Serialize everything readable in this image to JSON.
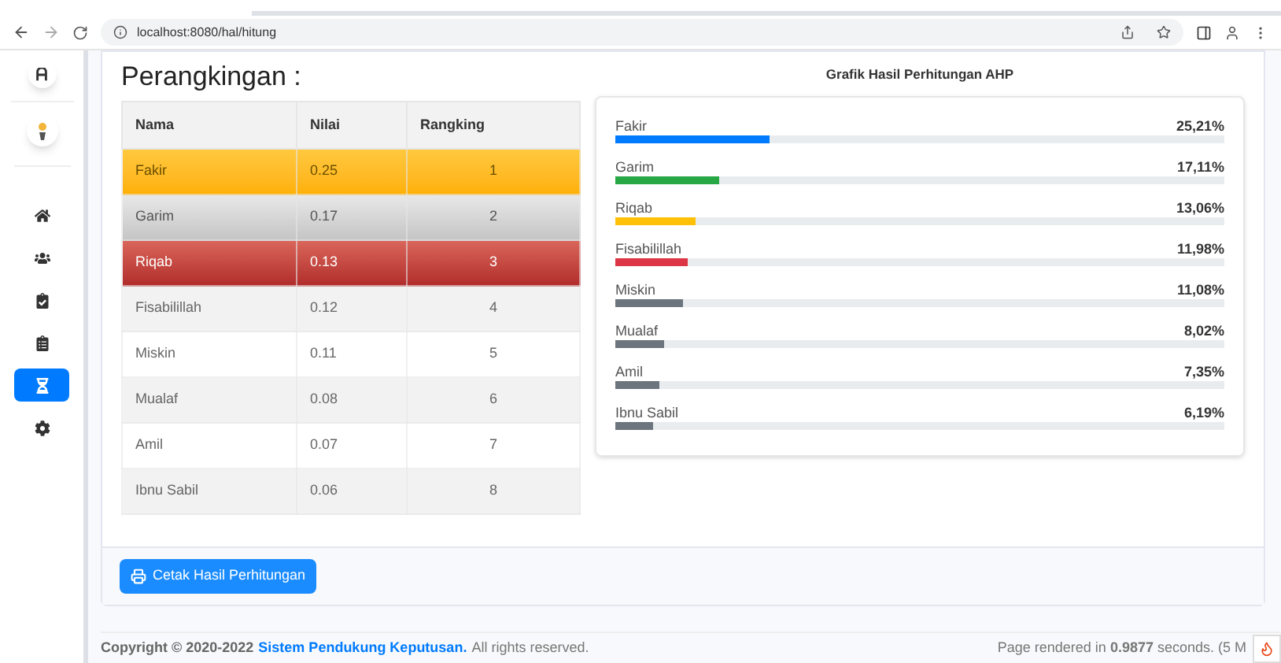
{
  "browser": {
    "url": "localhost:8080/hal/hitung"
  },
  "sidebar": {
    "items": [
      {
        "selected": false
      },
      {
        "selected": false
      },
      {
        "selected": false
      },
      {
        "selected": false
      },
      {
        "selected": true
      },
      {
        "selected": false
      }
    ]
  },
  "ranking": {
    "title": "Perangkingan :",
    "columns": [
      "Nama",
      "Nilai",
      "Rangking"
    ],
    "rows": [
      {
        "kind": "gold",
        "cells": [
          "Fakir",
          "0.25",
          "1"
        ]
      },
      {
        "kind": "silver",
        "cells": [
          "Garim",
          "0.17",
          "2"
        ]
      },
      {
        "kind": "bronze",
        "cells": [
          "Riqab",
          "0.13",
          "3"
        ]
      },
      {
        "kind": "plain",
        "cells": [
          "Fisabilillah",
          "0.12",
          "4"
        ]
      },
      {
        "kind": "plain",
        "cells": [
          "Miskin",
          "0.11",
          "5"
        ]
      },
      {
        "kind": "plain",
        "cells": [
          "Mualaf",
          "0.08",
          "6"
        ]
      },
      {
        "kind": "plain",
        "cells": [
          "Amil",
          "0.07",
          "7"
        ]
      },
      {
        "kind": "plain",
        "cells": [
          "Ibnu Sabil",
          "0.06",
          "8"
        ]
      }
    ]
  },
  "chart": {
    "title": "Grafik Hasil Perhitungan AHP",
    "bars": [
      {
        "label": "Fakir",
        "value": "25,21%",
        "level": 0.2521,
        "color": "#007bff"
      },
      {
        "label": "Garim",
        "value": "17,11%",
        "level": 0.1711,
        "color": "#28a745"
      },
      {
        "label": "Riqab",
        "value": "13,06%",
        "level": 0.1306,
        "color": "#ffc107"
      },
      {
        "label": "Fisabilillah",
        "value": "11,98%",
        "level": 0.1198,
        "color": "#dc3545"
      },
      {
        "label": "Miskin",
        "value": "11,08%",
        "level": 0.1108,
        "color": "#6c757d"
      },
      {
        "label": "Mualaf",
        "value": "8,02%",
        "level": 0.0802,
        "color": "#6c757d"
      },
      {
        "label": "Amil",
        "value": "7,35%",
        "level": 0.0735,
        "color": "#6c757d"
      },
      {
        "label": "Ibnu Sabil",
        "value": "6,19%",
        "level": 0.0619,
        "color": "#6c757d"
      }
    ]
  },
  "print_button": "Cetak Hasil Perhitungan",
  "footer": {
    "copyright": "Copyright © 2020-2022",
    "link": "Sistem Pendukung Keputusan.",
    "rights": "All rights reserved.",
    "rendered": "Page rendered in **0.9877** seconds. (5 M"
  }
}
